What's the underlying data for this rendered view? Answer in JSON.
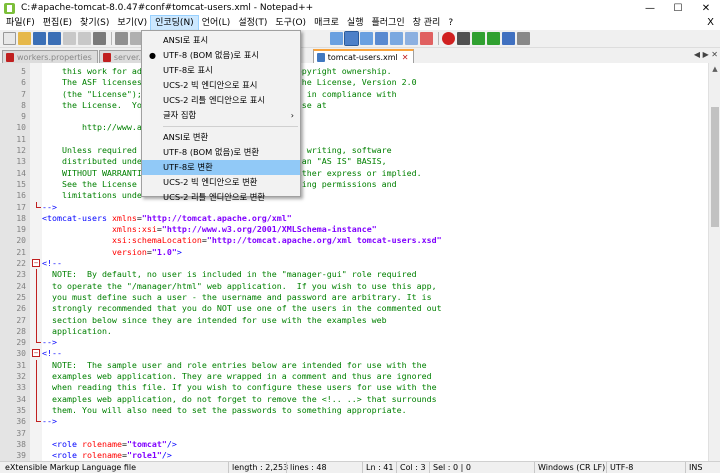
{
  "window": {
    "title": "C:#apache-tomcat-8.0.47#conf#tomcat-users.xml - Notepad++",
    "minimize": "—",
    "maximize": "☐",
    "close": "✕"
  },
  "menubar": {
    "items": [
      "파일(F)",
      "편집(E)",
      "찾기(S)",
      "보기(V)",
      "인코딩(N)",
      "언어(L)",
      "설정(T)",
      "도구(O)",
      "매크로",
      "실행",
      "플러그인",
      "창 관리",
      "?"
    ],
    "close": "X"
  },
  "tabs": [
    {
      "label": "workers.properties"
    },
    {
      "label": "server.xml"
    },
    {
      "label": "tomcat-users.xml",
      "current": true
    }
  ],
  "dropdown": {
    "items": [
      {
        "label": "ANSI로 표시",
        "checked": false
      },
      {
        "label": "UTF-8 (BOM 없음)로 표시",
        "checked": true
      },
      {
        "label": "UTF-8로 표시",
        "checked": false
      },
      {
        "label": "UCS-2 빅 엔디안으로 표시",
        "checked": false
      },
      {
        "label": "UCS-2 리틀 엔디안으로 표시",
        "checked": false
      },
      {
        "label": "글자 집합",
        "submenu": true
      },
      {
        "separator": true
      },
      {
        "label": "ANSI로 변환"
      },
      {
        "label": "UTF-8 (BOM 없음)로 변환"
      },
      {
        "label": "UTF-8로 변환",
        "highlight": true
      },
      {
        "label": "UCS-2 빅 엔디안으로 변환"
      },
      {
        "label": "UCS-2 리틀 엔디안으로 변환"
      }
    ],
    "check_glyph": "●",
    "submenu_glyph": "›"
  },
  "editor": {
    "lines": [
      {
        "n": "5",
        "segs": [
          [
            "cm",
            "    this work for ad                              copyright ownership."
          ]
        ]
      },
      {
        "n": "6",
        "segs": [
          [
            "cm",
            "    The ASF licenses                              ache License, Version 2.0"
          ]
        ]
      },
      {
        "n": "7",
        "segs": [
          [
            "cm",
            "    (the \"License\");                             ept in compliance with"
          ]
        ]
      },
      {
        "n": "8",
        "segs": [
          [
            "cm",
            "    the License.  Yo                              ense at"
          ]
        ]
      },
      {
        "n": "9",
        "segs": [
          [
            "cm",
            ""
          ]
        ]
      },
      {
        "n": "10",
        "segs": [
          [
            "cm",
            "        http://www.a"
          ]
        ]
      },
      {
        "n": "11",
        "segs": [
          [
            "cm",
            ""
          ]
        ]
      },
      {
        "n": "12",
        "segs": [
          [
            "cm",
            "    Unless required                               in writing, software"
          ]
        ]
      },
      {
        "n": "13",
        "segs": [
          [
            "cm",
            "    distributed unde                              s an \"AS IS\" BASIS,"
          ]
        ]
      },
      {
        "n": "14",
        "segs": [
          [
            "cm",
            "    WITHOUT WARRANTI                              either express or implied."
          ]
        ]
      },
      {
        "n": "15",
        "segs": [
          [
            "cm",
            "    See the License                               rning permissions and"
          ]
        ]
      },
      {
        "n": "16",
        "segs": [
          [
            "cm",
            "    limitations unde"
          ]
        ]
      },
      {
        "n": "17",
        "segs": [
          [
            "tag",
            "-->"
          ]
        ],
        "fold": "end"
      },
      {
        "n": "18",
        "segs": [
          [
            "tag",
            "<tomcat-users "
          ],
          [
            "attr",
            "xmlns"
          ],
          [
            "plain",
            "="
          ],
          [
            "val",
            "\"http://tomcat.apache.org/xml\""
          ]
        ]
      },
      {
        "n": "19",
        "segs": [
          [
            "plain",
            "              "
          ],
          [
            "attr",
            "xmlns:xsi"
          ],
          [
            "plain",
            "="
          ],
          [
            "val",
            "\"http://www.w3.org/2001/XMLSchema-instance\""
          ]
        ]
      },
      {
        "n": "20",
        "segs": [
          [
            "plain",
            "              "
          ],
          [
            "attr",
            "xsi:schemaLocation"
          ],
          [
            "plain",
            "="
          ],
          [
            "val",
            "\"http://tomcat.apache.org/xml tomcat-users.xsd\""
          ]
        ]
      },
      {
        "n": "21",
        "segs": [
          [
            "plain",
            "              "
          ],
          [
            "attr",
            "version"
          ],
          [
            "plain",
            "="
          ],
          [
            "val",
            "\"1.0\""
          ],
          [
            "tag",
            ">"
          ]
        ]
      },
      {
        "n": "22",
        "segs": [
          [
            "tag",
            "<!--"
          ]
        ],
        "fold": "start"
      },
      {
        "n": "23",
        "segs": [
          [
            "cm",
            "  NOTE:  By default, no user is included in the \"manager-gui\" role required"
          ]
        ],
        "fold": "mid"
      },
      {
        "n": "24",
        "segs": [
          [
            "cm",
            "  to operate the \"/manager/html\" web application.  If you wish to use this app,"
          ]
        ],
        "fold": "mid"
      },
      {
        "n": "25",
        "segs": [
          [
            "cm",
            "  you must define such a user - the username and password are arbitrary. It is"
          ]
        ],
        "fold": "mid"
      },
      {
        "n": "26",
        "segs": [
          [
            "cm",
            "  strongly recommended that you do NOT use one of the users in the commented out"
          ]
        ],
        "fold": "mid"
      },
      {
        "n": "27",
        "segs": [
          [
            "cm",
            "  section below since they are intended for use with the examples web"
          ]
        ],
        "fold": "mid"
      },
      {
        "n": "28",
        "segs": [
          [
            "cm",
            "  application."
          ]
        ],
        "fold": "mid"
      },
      {
        "n": "29",
        "segs": [
          [
            "tag",
            "-->"
          ]
        ],
        "fold": "end"
      },
      {
        "n": "30",
        "segs": [
          [
            "tag",
            "<!--"
          ]
        ],
        "fold": "start"
      },
      {
        "n": "31",
        "segs": [
          [
            "cm",
            "  NOTE:  The sample user and role entries below are intended for use with the"
          ]
        ],
        "fold": "mid"
      },
      {
        "n": "32",
        "segs": [
          [
            "cm",
            "  examples web application. They are wrapped in a comment and thus are ignored"
          ]
        ],
        "fold": "mid"
      },
      {
        "n": "33",
        "segs": [
          [
            "cm",
            "  when reading this file. If you wish to configure these users for use with the"
          ]
        ],
        "fold": "mid"
      },
      {
        "n": "34",
        "segs": [
          [
            "cm",
            "  examples web application, do not forget to remove the <!.. ..> that surrounds"
          ]
        ],
        "fold": "mid"
      },
      {
        "n": "35",
        "segs": [
          [
            "cm",
            "  them. You will also need to set the passwords to something appropriate."
          ]
        ],
        "fold": "mid"
      },
      {
        "n": "36",
        "segs": [
          [
            "tag",
            "-->"
          ]
        ],
        "fold": "end"
      },
      {
        "n": "37",
        "segs": [
          [
            "cm",
            ""
          ]
        ]
      },
      {
        "n": "38",
        "segs": [
          [
            "plain",
            "  "
          ],
          [
            "tag",
            "<role "
          ],
          [
            "attr",
            "rolename"
          ],
          [
            "plain",
            "="
          ],
          [
            "val",
            "\"tomcat\""
          ],
          [
            "tag",
            "/>"
          ]
        ]
      },
      {
        "n": "39",
        "segs": [
          [
            "plain",
            "  "
          ],
          [
            "tag",
            "<role "
          ],
          [
            "attr",
            "rolename"
          ],
          [
            "plain",
            "="
          ],
          [
            "val",
            "\"role1\""
          ],
          [
            "tag",
            "/>"
          ]
        ]
      }
    ]
  },
  "statusbar": {
    "file_type": "eXtensible Markup Language file",
    "length": "length : 2,253",
    "lines": "lines : 48",
    "ln": "Ln : 41",
    "col": "Col : 3",
    "sel": "Sel : 0 | 0",
    "eol": "Windows (CR LF)",
    "encoding": "UTF-8",
    "mode": "INS"
  },
  "colors": {
    "comment": "#008000",
    "tag": "#0000ff",
    "attribute": "#ff0000",
    "value": "#8000ff",
    "menu_highlight": "#91c9f7",
    "active_tab_accent": "#f9a33a"
  }
}
